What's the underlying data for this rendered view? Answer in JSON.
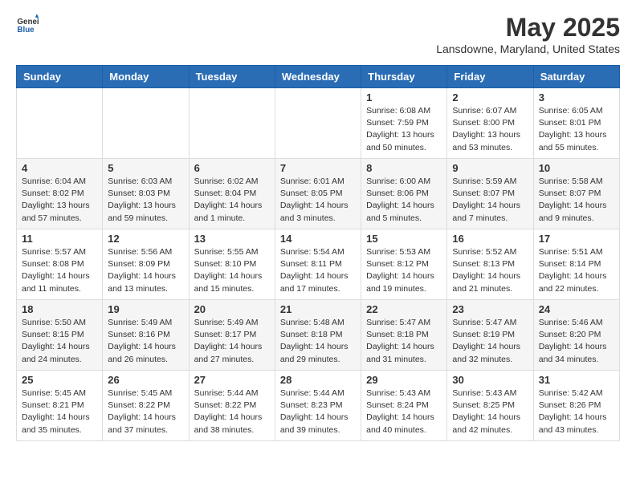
{
  "logo": {
    "text_general": "General",
    "text_blue": "Blue"
  },
  "title": "May 2025",
  "subtitle": "Lansdowne, Maryland, United States",
  "weekdays": [
    "Sunday",
    "Monday",
    "Tuesday",
    "Wednesday",
    "Thursday",
    "Friday",
    "Saturday"
  ],
  "weeks": [
    [
      {
        "day": "",
        "info": ""
      },
      {
        "day": "",
        "info": ""
      },
      {
        "day": "",
        "info": ""
      },
      {
        "day": "",
        "info": ""
      },
      {
        "day": "1",
        "info": "Sunrise: 6:08 AM\nSunset: 7:59 PM\nDaylight: 13 hours\nand 50 minutes."
      },
      {
        "day": "2",
        "info": "Sunrise: 6:07 AM\nSunset: 8:00 PM\nDaylight: 13 hours\nand 53 minutes."
      },
      {
        "day": "3",
        "info": "Sunrise: 6:05 AM\nSunset: 8:01 PM\nDaylight: 13 hours\nand 55 minutes."
      }
    ],
    [
      {
        "day": "4",
        "info": "Sunrise: 6:04 AM\nSunset: 8:02 PM\nDaylight: 13 hours\nand 57 minutes."
      },
      {
        "day": "5",
        "info": "Sunrise: 6:03 AM\nSunset: 8:03 PM\nDaylight: 13 hours\nand 59 minutes."
      },
      {
        "day": "6",
        "info": "Sunrise: 6:02 AM\nSunset: 8:04 PM\nDaylight: 14 hours\nand 1 minute."
      },
      {
        "day": "7",
        "info": "Sunrise: 6:01 AM\nSunset: 8:05 PM\nDaylight: 14 hours\nand 3 minutes."
      },
      {
        "day": "8",
        "info": "Sunrise: 6:00 AM\nSunset: 8:06 PM\nDaylight: 14 hours\nand 5 minutes."
      },
      {
        "day": "9",
        "info": "Sunrise: 5:59 AM\nSunset: 8:07 PM\nDaylight: 14 hours\nand 7 minutes."
      },
      {
        "day": "10",
        "info": "Sunrise: 5:58 AM\nSunset: 8:07 PM\nDaylight: 14 hours\nand 9 minutes."
      }
    ],
    [
      {
        "day": "11",
        "info": "Sunrise: 5:57 AM\nSunset: 8:08 PM\nDaylight: 14 hours\nand 11 minutes."
      },
      {
        "day": "12",
        "info": "Sunrise: 5:56 AM\nSunset: 8:09 PM\nDaylight: 14 hours\nand 13 minutes."
      },
      {
        "day": "13",
        "info": "Sunrise: 5:55 AM\nSunset: 8:10 PM\nDaylight: 14 hours\nand 15 minutes."
      },
      {
        "day": "14",
        "info": "Sunrise: 5:54 AM\nSunset: 8:11 PM\nDaylight: 14 hours\nand 17 minutes."
      },
      {
        "day": "15",
        "info": "Sunrise: 5:53 AM\nSunset: 8:12 PM\nDaylight: 14 hours\nand 19 minutes."
      },
      {
        "day": "16",
        "info": "Sunrise: 5:52 AM\nSunset: 8:13 PM\nDaylight: 14 hours\nand 21 minutes."
      },
      {
        "day": "17",
        "info": "Sunrise: 5:51 AM\nSunset: 8:14 PM\nDaylight: 14 hours\nand 22 minutes."
      }
    ],
    [
      {
        "day": "18",
        "info": "Sunrise: 5:50 AM\nSunset: 8:15 PM\nDaylight: 14 hours\nand 24 minutes."
      },
      {
        "day": "19",
        "info": "Sunrise: 5:49 AM\nSunset: 8:16 PM\nDaylight: 14 hours\nand 26 minutes."
      },
      {
        "day": "20",
        "info": "Sunrise: 5:49 AM\nSunset: 8:17 PM\nDaylight: 14 hours\nand 27 minutes."
      },
      {
        "day": "21",
        "info": "Sunrise: 5:48 AM\nSunset: 8:18 PM\nDaylight: 14 hours\nand 29 minutes."
      },
      {
        "day": "22",
        "info": "Sunrise: 5:47 AM\nSunset: 8:18 PM\nDaylight: 14 hours\nand 31 minutes."
      },
      {
        "day": "23",
        "info": "Sunrise: 5:47 AM\nSunset: 8:19 PM\nDaylight: 14 hours\nand 32 minutes."
      },
      {
        "day": "24",
        "info": "Sunrise: 5:46 AM\nSunset: 8:20 PM\nDaylight: 14 hours\nand 34 minutes."
      }
    ],
    [
      {
        "day": "25",
        "info": "Sunrise: 5:45 AM\nSunset: 8:21 PM\nDaylight: 14 hours\nand 35 minutes."
      },
      {
        "day": "26",
        "info": "Sunrise: 5:45 AM\nSunset: 8:22 PM\nDaylight: 14 hours\nand 37 minutes."
      },
      {
        "day": "27",
        "info": "Sunrise: 5:44 AM\nSunset: 8:22 PM\nDaylight: 14 hours\nand 38 minutes."
      },
      {
        "day": "28",
        "info": "Sunrise: 5:44 AM\nSunset: 8:23 PM\nDaylight: 14 hours\nand 39 minutes."
      },
      {
        "day": "29",
        "info": "Sunrise: 5:43 AM\nSunset: 8:24 PM\nDaylight: 14 hours\nand 40 minutes."
      },
      {
        "day": "30",
        "info": "Sunrise: 5:43 AM\nSunset: 8:25 PM\nDaylight: 14 hours\nand 42 minutes."
      },
      {
        "day": "31",
        "info": "Sunrise: 5:42 AM\nSunset: 8:26 PM\nDaylight: 14 hours\nand 43 minutes."
      }
    ]
  ]
}
